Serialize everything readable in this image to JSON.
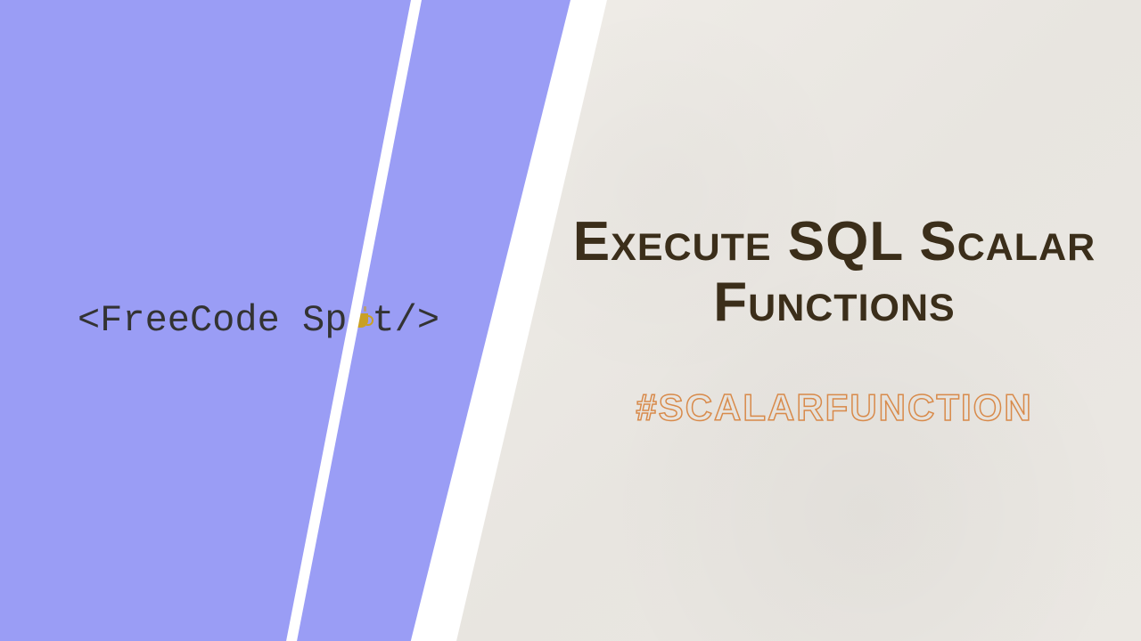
{
  "logo": {
    "prefix": "<FreeCode Sp",
    "suffix": "t/>"
  },
  "content": {
    "title_line1": "Execute SQL Scalar",
    "title_line2": "Functions",
    "hashtag": "#SCALARFUNCTION"
  },
  "colors": {
    "left_bg": "#9a9df5",
    "right_bg": "#f0ede8",
    "title_color": "#3b2e1a",
    "hashtag_stroke": "#d88a4a",
    "divider": "#ffffff"
  }
}
